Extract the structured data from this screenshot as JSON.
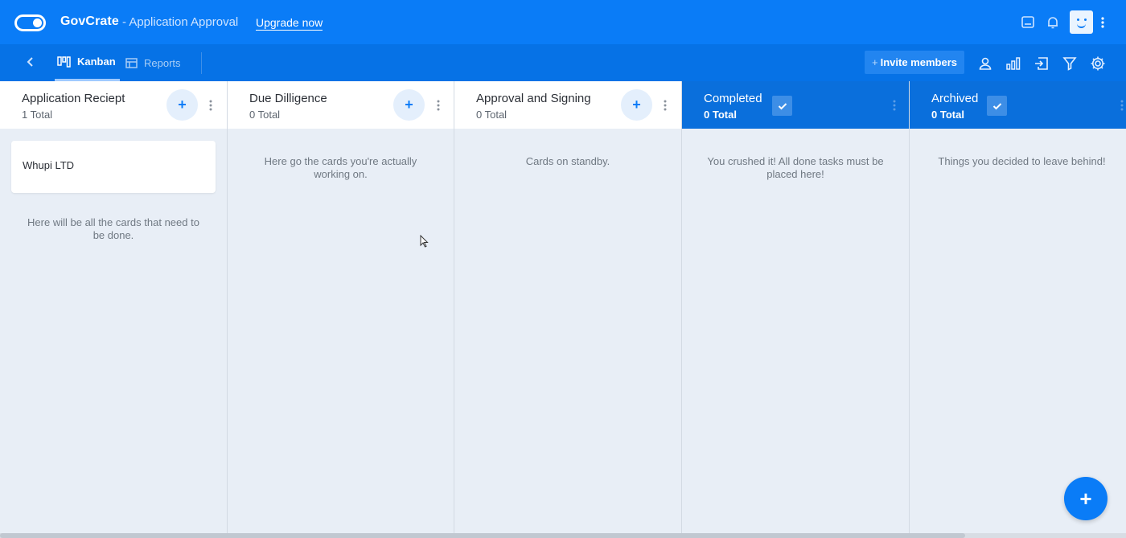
{
  "header": {
    "app_name": "GovCrate",
    "board_name": "- Application Approval",
    "upgrade_label": "Upgrade now"
  },
  "toolbar": {
    "tabs": [
      {
        "label": "Kanban",
        "active": true
      },
      {
        "label": "Reports",
        "active": false
      }
    ],
    "invite_plus": "+",
    "invite_label": "Invite members"
  },
  "columns": [
    {
      "title": "Application Reciept",
      "count": "1 Total",
      "empty_text": "Here will be all the cards that need to be done.",
      "cards": [
        {
          "title": "Whupi LTD"
        }
      ]
    },
    {
      "title": "Due Dilligence",
      "count": "0 Total",
      "empty_text": "Here go the cards you're actually working on.",
      "cards": []
    },
    {
      "title": "Approval and Signing",
      "count": "0 Total",
      "empty_text": "Cards on standby.",
      "cards": []
    },
    {
      "title": "Completed",
      "count": "0 Total",
      "empty_text": "You crushed it! All done tasks must be placed here!",
      "cards": []
    },
    {
      "title": "Archived",
      "count": "0 Total",
      "empty_text": "Things you decided to leave behind!",
      "cards": []
    }
  ],
  "add_glyph": "+",
  "fab_glyph": "+",
  "colors": {
    "primary": "#0a7cf7",
    "toolbar": "#0672e6",
    "done_column": "#0a6fdc",
    "board_bg": "#e8eef6"
  }
}
